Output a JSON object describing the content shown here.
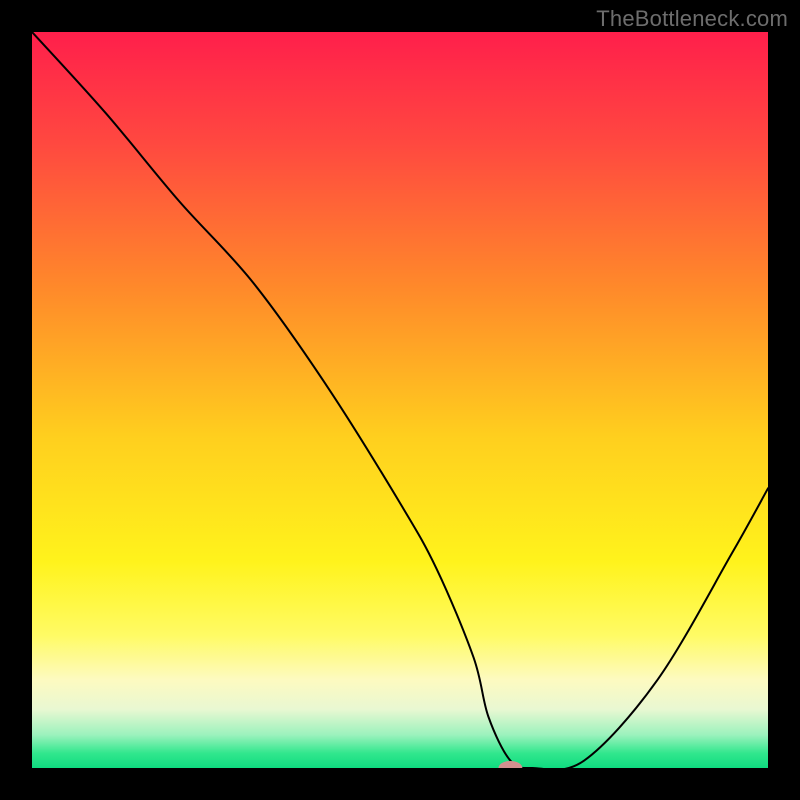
{
  "watermark": "TheBottleneck.com",
  "chart_data": {
    "type": "line",
    "title": "",
    "xlabel": "",
    "ylabel": "",
    "xlim": [
      0,
      100
    ],
    "ylim": [
      0,
      100
    ],
    "grid": false,
    "legend": false,
    "series": [
      {
        "name": "curve",
        "x": [
          0,
          10,
          20,
          30,
          40,
          50,
          55,
          60,
          62,
          65,
          68,
          75,
          85,
          95,
          100
        ],
        "y": [
          100,
          89,
          77,
          66,
          52,
          36,
          27,
          15,
          7,
          1,
          0,
          1,
          12,
          29,
          38
        ]
      }
    ],
    "marker": {
      "x": 65,
      "y": 0,
      "color": "#d38f8f",
      "rx": 12,
      "ry": 7
    },
    "gradient_stops": [
      {
        "offset": 0.0,
        "color": "#ff1f4b"
      },
      {
        "offset": 0.15,
        "color": "#ff4840"
      },
      {
        "offset": 0.35,
        "color": "#ff8a2a"
      },
      {
        "offset": 0.55,
        "color": "#ffcf1e"
      },
      {
        "offset": 0.72,
        "color": "#fff31c"
      },
      {
        "offset": 0.82,
        "color": "#fffb65"
      },
      {
        "offset": 0.88,
        "color": "#fdfac0"
      },
      {
        "offset": 0.92,
        "color": "#e9f8d2"
      },
      {
        "offset": 0.955,
        "color": "#9cf2bd"
      },
      {
        "offset": 0.98,
        "color": "#31e78d"
      },
      {
        "offset": 1.0,
        "color": "#0fdb80"
      }
    ]
  }
}
